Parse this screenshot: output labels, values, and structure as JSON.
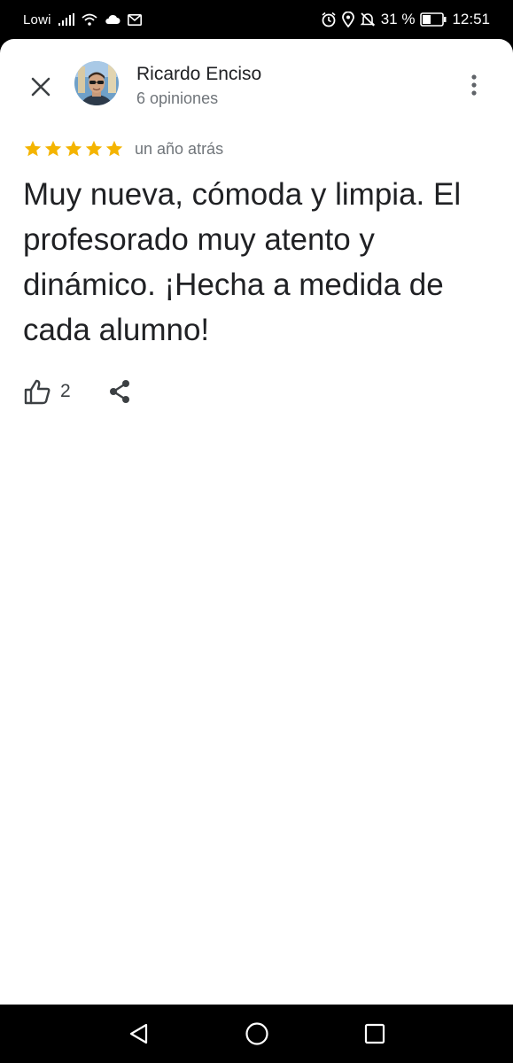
{
  "status_bar": {
    "carrier": "Lowi",
    "battery_percent": "31 %",
    "time": "12:51",
    "icons": [
      "signal-icon",
      "wifi-icon",
      "cloud-icon",
      "gmail-icon",
      "alarm-icon",
      "location-icon",
      "mute-icon",
      "battery-icon"
    ]
  },
  "review": {
    "author": {
      "name": "Ricardo Enciso",
      "review_count": "6 opiniones"
    },
    "rating": 5,
    "max_rating": 5,
    "date": "un año atrás",
    "text": "Muy nueva, cómoda y limpia. El profesorado muy atento y dinámico. ¡Hecha a medida de cada alumno!",
    "likes": "2"
  },
  "colors": {
    "star": "#F4B400",
    "primary_text": "#202124",
    "secondary_text": "#70757a",
    "icon": "#3c4043"
  },
  "nav": {
    "buttons": [
      "back-icon",
      "home-icon",
      "recents-icon"
    ]
  }
}
